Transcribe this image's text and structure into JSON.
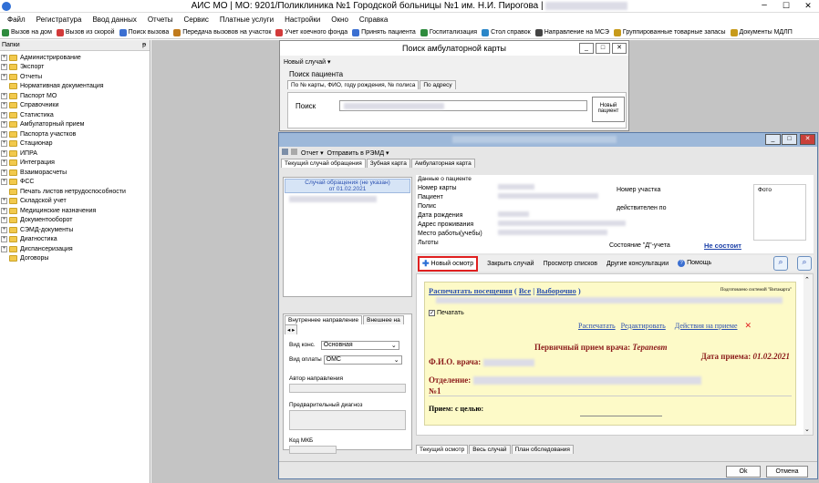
{
  "app": {
    "title": "АИС МО | МО: 9201/Поликлиника №1 Городской больницы №1 им. Н.И. Пирогова |"
  },
  "menu": [
    "Файл",
    "Регистратура",
    "Ввод данных",
    "Отчеты",
    "Сервис",
    "Платные услуги",
    "Настройки",
    "Окно",
    "Справка"
  ],
  "toolbar": [
    {
      "label": "Вызов на дом",
      "icon": "house-icon",
      "color": "#2e8b3d"
    },
    {
      "label": "Вызов из скорой",
      "icon": "ambulance-icon",
      "color": "#d23a3a"
    },
    {
      "label": "Поиск вызова",
      "icon": "search-call-icon",
      "color": "#3b6fd1"
    },
    {
      "label": "Передача вызовов на участок",
      "icon": "transfer-icon",
      "color": "#c07a1c"
    },
    {
      "label": "Учет коечного фонда",
      "icon": "bed-icon",
      "color": "#d23a3a"
    },
    {
      "label": "Принять пациента",
      "icon": "patient-icon",
      "color": "#3b6fd1"
    },
    {
      "label": "Госпитализация",
      "icon": "hospital-icon",
      "color": "#2e8b3d"
    },
    {
      "label": "Стол справок",
      "icon": "info-desk-icon",
      "color": "#2a86c8"
    },
    {
      "label": "Направление на МСЭ",
      "icon": "referral-icon",
      "color": "#444444"
    },
    {
      "label": "Группированные товарные запасы",
      "icon": "stock-icon",
      "color": "#c79a1a"
    },
    {
      "label": "Документы МДЛП",
      "icon": "documents-icon",
      "color": "#c79a1a"
    }
  ],
  "sidebar": {
    "header": "Папки",
    "pin": "ᵽ",
    "items": [
      {
        "label": "Администрирование",
        "exp": "+"
      },
      {
        "label": "Экспорт",
        "exp": "+"
      },
      {
        "label": "Отчеты",
        "exp": "+"
      },
      {
        "label": "Нормативная документация",
        "exp": ""
      },
      {
        "label": "Паспорт МО",
        "exp": "+"
      },
      {
        "label": "Справочники",
        "exp": "+"
      },
      {
        "label": "Статистика",
        "exp": "+"
      },
      {
        "label": "Амбулаторный прием",
        "exp": "+"
      },
      {
        "label": "Паспорта участков",
        "exp": "+"
      },
      {
        "label": "Стационар",
        "exp": "+"
      },
      {
        "label": "ИПРА",
        "exp": "+"
      },
      {
        "label": "Интеграция",
        "exp": "+"
      },
      {
        "label": "Взаиморасчеты",
        "exp": "+"
      },
      {
        "label": "ФСС",
        "exp": "+"
      },
      {
        "label": "Печать листов нетрудоспособности",
        "exp": ""
      },
      {
        "label": "Складской учет",
        "exp": "+"
      },
      {
        "label": "Медицинские назначения",
        "exp": "+"
      },
      {
        "label": "Документооборот",
        "exp": "+"
      },
      {
        "label": "СЭМД-документы",
        "exp": "+"
      },
      {
        "label": "Диагностика",
        "exp": "+"
      },
      {
        "label": "Диспансеризация",
        "exp": "+"
      },
      {
        "label": "Договоры",
        "exp": ""
      }
    ]
  },
  "search_win": {
    "title": "Поиск амбулаторной карты",
    "new_case": "Новый случай ▾",
    "group": "Поиск пациента",
    "tab1": "По № карты, ФИО, году рождения, № полиса",
    "tab2": "По адресу",
    "search_label": "Поиск",
    "new_patient": "Новый пациент"
  },
  "card_win": {
    "tool_report": "Отчет ▾",
    "tool_send": "Отправить в РЭМД ▾",
    "tabs": [
      "Текущий случай обращения",
      "Зубная карта",
      "Амбулаторная карта"
    ],
    "case_item": "Случай обращения (не указан)",
    "case_date": "от 01.02.2021",
    "patient_title": "Данные о пациенте",
    "photo": "Фото",
    "rows": [
      "Номер карты",
      "Пациент",
      "Полис",
      "Дата рождения",
      "Адрес проживания",
      "Место работы(учебы)",
      "Льготы"
    ],
    "uchastok": "Номер участка",
    "valid": "действителен по",
    "d_status": "Состояние \"Д\"-учета",
    "d_value": "Не состоит",
    "actions": {
      "new_exam": "Новый осмотр",
      "close_case": "Закрыть случай",
      "view_lists": "Просмотр списков",
      "other": "Другие консультации",
      "help": "Помощь"
    },
    "ref_tabs": [
      "Внутреннее направление",
      "Внешнее на"
    ],
    "vid_kons": "Вид конс.",
    "vid_kons_val": "Основная",
    "vid_opl": "Вид оплаты",
    "vid_opl_val": "ОМС",
    "author": "Автор направления",
    "prediag": "Предварительный диагноз",
    "mkb": "Код МКБ",
    "doc": {
      "print_visits": "Распечатать посещения",
      "open_paren": "(",
      "all": "Все",
      "sep": "|",
      "selected": "Выборочно",
      "close_paren": ")",
      "vendor": "Подготовлено системой \"Витакарта\"",
      "print_check": "Печатать",
      "print": "Распечатать",
      "edit": "Редактировать",
      "actions": "Действия на приеме",
      "heading": "Первичный прием врача:",
      "specialty": "Терапевт",
      "date_label": "Дата приема:",
      "date_val": "01.02.2021",
      "fio": "Ф.И.О. врача:",
      "dept": "Отделение:",
      "num": "№1",
      "goal": "Прием: с целью:"
    },
    "bottom_tabs": [
      "Текущий осмотр",
      "Весь случай",
      "План обследования"
    ],
    "ok": "Ok",
    "cancel": "Отмена"
  },
  "colors": {
    "accent": "#2a4fb0",
    "highlight": "#e02020",
    "doc_bg": "#fdfac8",
    "heading": "#8b1a1a"
  }
}
